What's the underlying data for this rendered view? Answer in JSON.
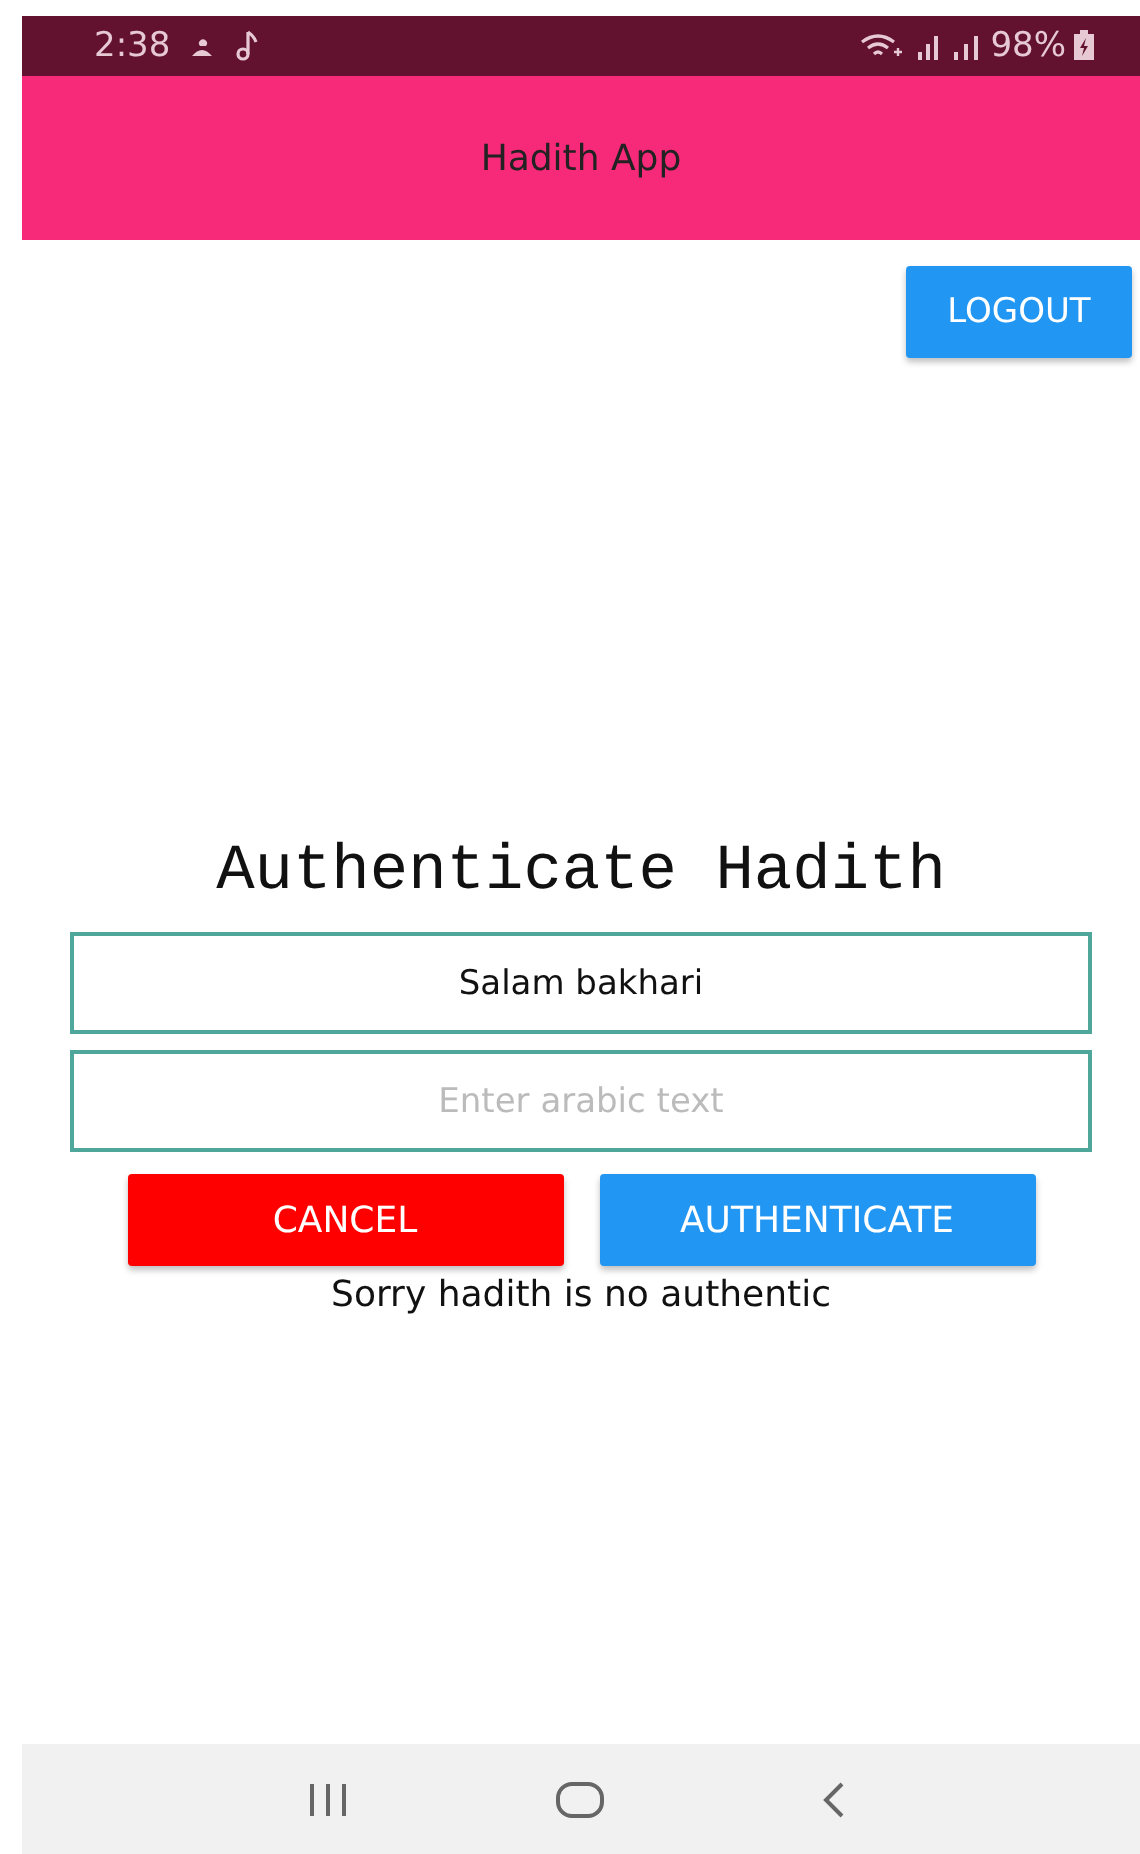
{
  "status_bar": {
    "time": "2:38",
    "battery": "98%"
  },
  "app_bar": {
    "title": "Hadith App"
  },
  "logout_button": "LOGOUT",
  "heading": "Authenticate Hadith",
  "fields": [
    {
      "kind": "value",
      "value": "Salam bakhari"
    },
    {
      "kind": "placeholder",
      "placeholder": "Enter arabic text"
    }
  ],
  "buttons": [
    {
      "label": "CANCEL",
      "kind": "cancel"
    },
    {
      "label": "AUTHENTICATE",
      "kind": "primary"
    }
  ],
  "message": "Sorry hadith is no authentic"
}
